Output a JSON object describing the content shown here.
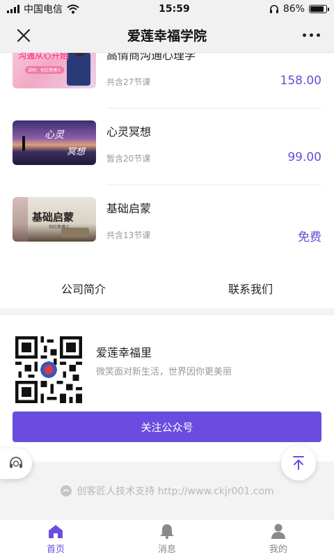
{
  "status_bar": {
    "carrier": "中国电信",
    "time": "15:59",
    "battery": "86%",
    "battery_level": 0.86
  },
  "nav": {
    "title": "爱莲幸福学院"
  },
  "courses": [
    {
      "title": "高情商沟通心理学",
      "lessons": "共含27节课",
      "price": "158.00",
      "thumb_text": "沟通从心开始",
      "thumb_subtext": "讲师：何红燕博士"
    },
    {
      "title": "心灵冥想",
      "lessons": "暂含20节课",
      "price": "99.00",
      "thumb_text_1": "心灵",
      "thumb_text_2": "冥想"
    },
    {
      "title": "基础启蒙",
      "lessons": "共含13节课",
      "price": "免费",
      "thumb_text": "基础启蒙",
      "thumb_subtext": "何红燕博士"
    }
  ],
  "links": {
    "about": "公司简介",
    "contact": "联系我们"
  },
  "follow": {
    "name": "爱莲幸福里",
    "desc": "微笑面对新生活，世界因你更美丽",
    "button": "关注公众号"
  },
  "footer": {
    "support": "创客匠人技术支持  http://www.ckjr001.com"
  },
  "tabs": [
    {
      "label": "首页",
      "icon": "home-icon"
    },
    {
      "label": "消息",
      "icon": "bell-icon"
    },
    {
      "label": "我的",
      "icon": "user-icon"
    }
  ],
  "colors": {
    "accent": "#6a4de0",
    "price": "#6a4bd8"
  }
}
